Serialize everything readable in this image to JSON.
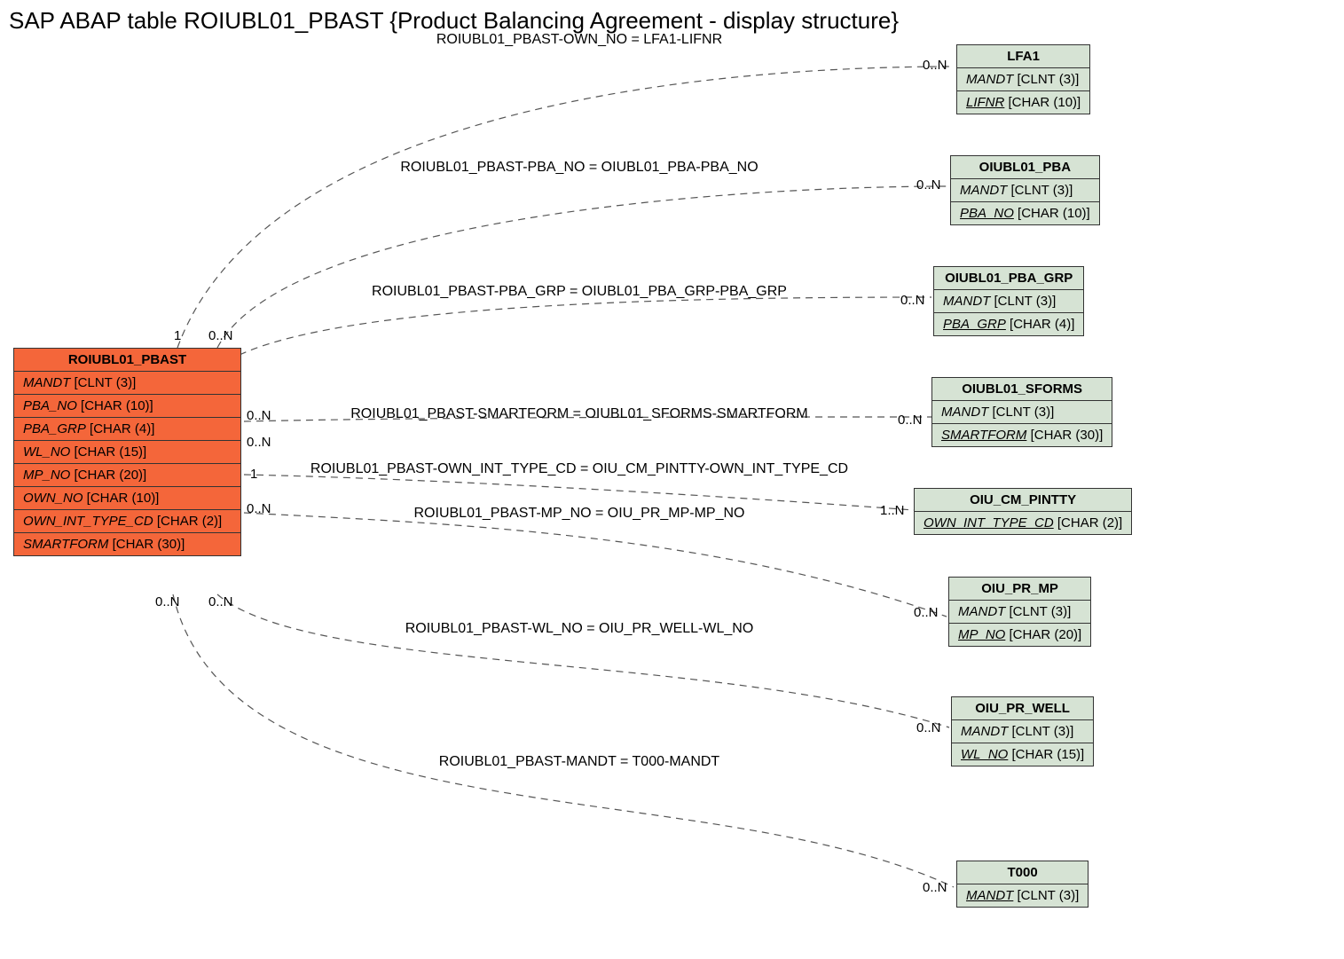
{
  "title": "SAP ABAP table ROIUBL01_PBAST {Product Balancing Agreement - display structure}",
  "main_entity": {
    "name": "ROIUBL01_PBAST",
    "fields": [
      {
        "name": "MANDT",
        "type": "[CLNT (3)]"
      },
      {
        "name": "PBA_NO",
        "type": "[CHAR (10)]"
      },
      {
        "name": "PBA_GRP",
        "type": "[CHAR (4)]"
      },
      {
        "name": "WL_NO",
        "type": "[CHAR (15)]"
      },
      {
        "name": "MP_NO",
        "type": "[CHAR (20)]"
      },
      {
        "name": "OWN_NO",
        "type": "[CHAR (10)]"
      },
      {
        "name": "OWN_INT_TYPE_CD",
        "type": "[CHAR (2)]"
      },
      {
        "name": "SMARTFORM",
        "type": "[CHAR (30)]"
      }
    ]
  },
  "targets": [
    {
      "name": "LFA1",
      "fields": [
        {
          "name": "MANDT",
          "type": "[CLNT (3)]",
          "ul": false
        },
        {
          "name": "LIFNR",
          "type": "[CHAR (10)]",
          "ul": true
        }
      ]
    },
    {
      "name": "OIUBL01_PBA",
      "fields": [
        {
          "name": "MANDT",
          "type": "[CLNT (3)]",
          "ul": false
        },
        {
          "name": "PBA_NO",
          "type": "[CHAR (10)]",
          "ul": true
        }
      ]
    },
    {
      "name": "OIUBL01_PBA_GRP",
      "fields": [
        {
          "name": "MANDT",
          "type": "[CLNT (3)]",
          "ul": false
        },
        {
          "name": "PBA_GRP",
          "type": "[CHAR (4)]",
          "ul": true
        }
      ]
    },
    {
      "name": "OIUBL01_SFORMS",
      "fields": [
        {
          "name": "MANDT",
          "type": "[CLNT (3)]",
          "ul": false
        },
        {
          "name": "SMARTFORM",
          "type": "[CHAR (30)]",
          "ul": true
        }
      ]
    },
    {
      "name": "OIU_CM_PINTTY",
      "fields": [
        {
          "name": "OWN_INT_TYPE_CD",
          "type": "[CHAR (2)]",
          "ul": true
        }
      ]
    },
    {
      "name": "OIU_PR_MP",
      "fields": [
        {
          "name": "MANDT",
          "type": "[CLNT (3)]",
          "ul": false
        },
        {
          "name": "MP_NO",
          "type": "[CHAR (20)]",
          "ul": true
        }
      ]
    },
    {
      "name": "OIU_PR_WELL",
      "fields": [
        {
          "name": "MANDT",
          "type": "[CLNT (3)]",
          "ul": false
        },
        {
          "name": "WL_NO",
          "type": "[CHAR (15)]",
          "ul": true
        }
      ]
    },
    {
      "name": "T000",
      "fields": [
        {
          "name": "MANDT",
          "type": "[CLNT (3)]",
          "ul": true
        }
      ]
    }
  ],
  "relations": [
    {
      "label": "ROIUBL01_PBAST-OWN_NO = LFA1-LIFNR",
      "src_card": "1",
      "dst_card": "0..N"
    },
    {
      "label": "ROIUBL01_PBAST-PBA_NO = OIUBL01_PBA-PBA_NO",
      "src_card": "0..N",
      "dst_card": "0..N"
    },
    {
      "label": "ROIUBL01_PBAST-PBA_GRP = OIUBL01_PBA_GRP-PBA_GRP",
      "src_card": "",
      "dst_card": "0..N"
    },
    {
      "label": "ROIUBL01_PBAST-SMARTFORM = OIUBL01_SFORMS-SMARTFORM",
      "src_card": "0..N",
      "dst_card": "0..N"
    },
    {
      "label": "ROIUBL01_PBAST-OWN_INT_TYPE_CD = OIU_CM_PINTTY-OWN_INT_TYPE_CD",
      "src_card": "0..N",
      "dst_card": "1..N"
    },
    {
      "label": "ROIUBL01_PBAST-MP_NO = OIU_PR_MP-MP_NO",
      "src_card": "1",
      "dst_card": "0..N"
    },
    {
      "label": "ROIUBL01_PBAST-WL_NO = OIU_PR_WELL-WL_NO",
      "src_card": "0..N",
      "dst_card": "0..N"
    },
    {
      "label": "ROIUBL01_PBAST-MANDT = T000-MANDT",
      "src_card": "0..N",
      "dst_card": "0..N"
    }
  ],
  "extra_card": "0..N"
}
